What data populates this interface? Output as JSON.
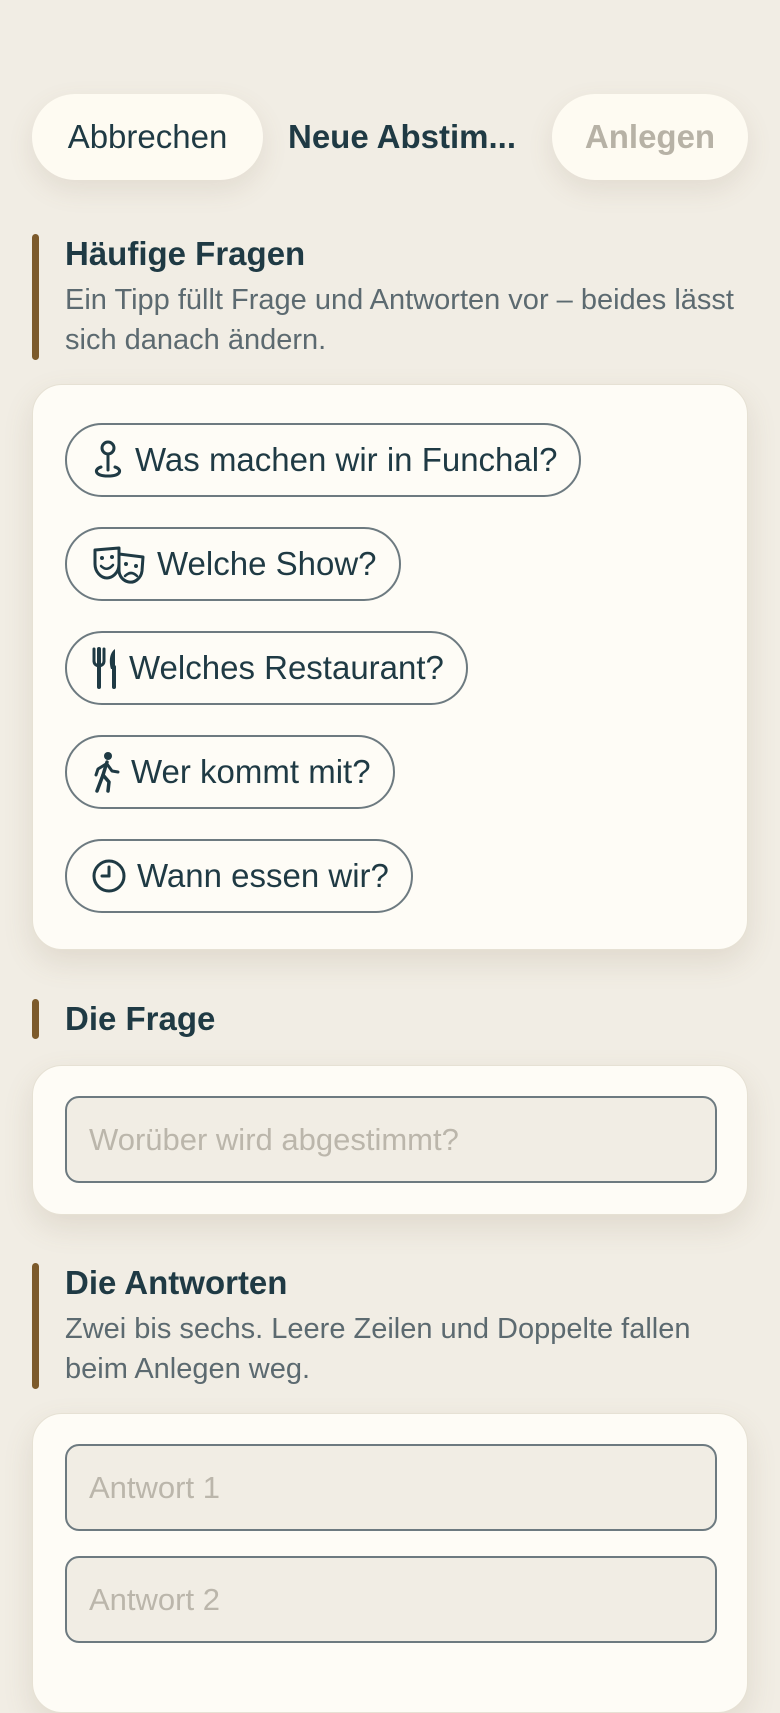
{
  "header": {
    "cancel_label": "Abbrechen",
    "title": "Neue Abstim...",
    "create_label": "Anlegen"
  },
  "faq": {
    "title": "Häufige Fragen",
    "subtitle": "Ein Tipp füllt Frage und Antworten vor – beides lässt sich danach ändern.",
    "suggestions": [
      {
        "icon": "location-pin-icon",
        "label": "Was machen wir in Funchal?"
      },
      {
        "icon": "theater-masks-icon",
        "label": "Welche Show?"
      },
      {
        "icon": "fork-knife-icon",
        "label": "Welches Restaurant?"
      },
      {
        "icon": "walking-person-icon",
        "label": "Wer kommt mit?"
      },
      {
        "icon": "clock-icon",
        "label": "Wann essen wir?"
      }
    ]
  },
  "question": {
    "title": "Die Frage",
    "placeholder": "Worüber wird abgestimmt?",
    "value": ""
  },
  "answers": {
    "title": "Die Antworten",
    "subtitle": "Zwei bis sechs. Leere Zeilen und Doppelte fallen beim Anlegen weg.",
    "fields": [
      {
        "placeholder": "Antwort 1",
        "value": ""
      },
      {
        "placeholder": "Antwort 2",
        "value": ""
      }
    ]
  },
  "colors": {
    "background": "#F1EDE4",
    "card": "#FEFCF6",
    "accent_bar": "#7C5A2B",
    "text": "#1F3A44",
    "muted_text": "#5C6A70",
    "disabled_text": "#B7B2A6",
    "border": "#6D7A80"
  }
}
